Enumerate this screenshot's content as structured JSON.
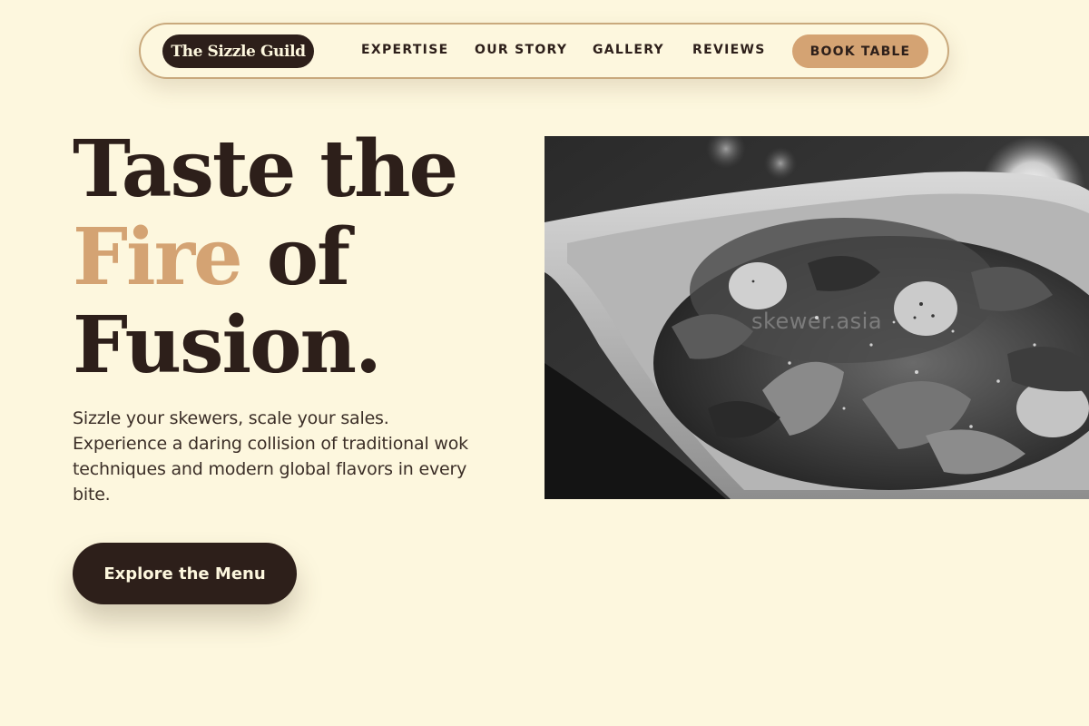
{
  "nav": {
    "logo": "The Sizzle Guild",
    "links": [
      "EXPERTISE",
      "OUR STORY",
      "GALLERY",
      "REVIEWS"
    ],
    "book_label": "BOOK TABLE"
  },
  "hero": {
    "title_line1": "Taste the",
    "title_accent": "Fire",
    "title_line2_rest": " of",
    "title_line3": "Fusion.",
    "description": "Sizzle your skewers, scale your sales. Experience a daring collision of traditional wok techniques and modern global flavors in every bite.",
    "cta_label": "Explore the Menu",
    "image_caption": "skewer.asia"
  },
  "colors": {
    "background": "#fdf7de",
    "dark": "#2d1f1a",
    "accent": "#d4a373"
  }
}
